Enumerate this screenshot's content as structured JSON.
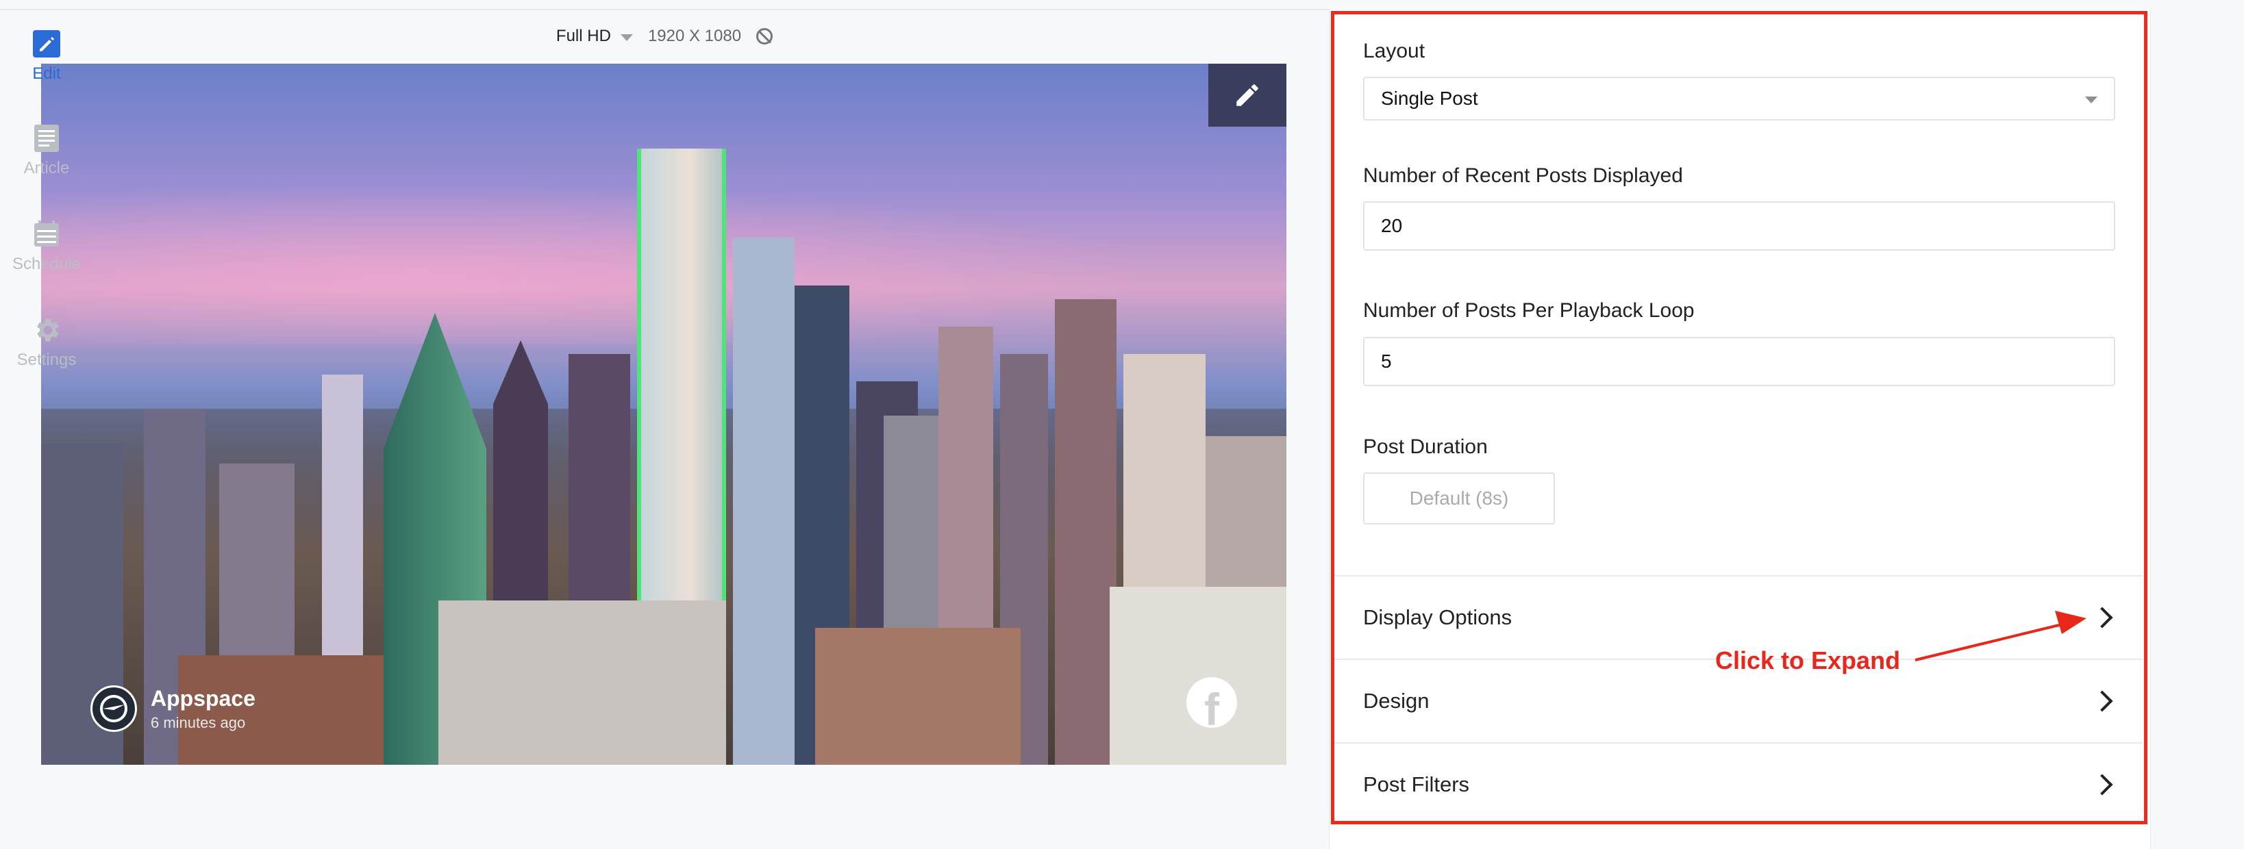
{
  "preview": {
    "resolution_label": "Full HD",
    "resolution_dims": "1920 X 1080",
    "author_name": "Appspace",
    "author_time": "6 minutes ago"
  },
  "panel": {
    "layout_label": "Layout",
    "layout_value": "Single Post",
    "recent_posts_label": "Number of Recent Posts Displayed",
    "recent_posts_value": "20",
    "loop_label": "Number of Posts Per Playback Loop",
    "loop_value": "5",
    "duration_label": "Post Duration",
    "duration_button": "Default (8s)",
    "sections": [
      {
        "label": "Display Options"
      },
      {
        "label": "Design"
      },
      {
        "label": "Post Filters"
      }
    ]
  },
  "annotation": {
    "text": "Click to Expand",
    "color": "#e8271b"
  },
  "rail": {
    "items": [
      {
        "label": "Edit",
        "icon": "pencil-icon",
        "active": true
      },
      {
        "label": "Article",
        "icon": "article-icon",
        "active": false
      },
      {
        "label": "Schedule",
        "icon": "calendar-icon",
        "active": false
      },
      {
        "label": "Settings",
        "icon": "gear-icon",
        "active": false
      }
    ]
  },
  "colors": {
    "accent": "#2b6bd6",
    "highlight": "#ee2a1d"
  }
}
